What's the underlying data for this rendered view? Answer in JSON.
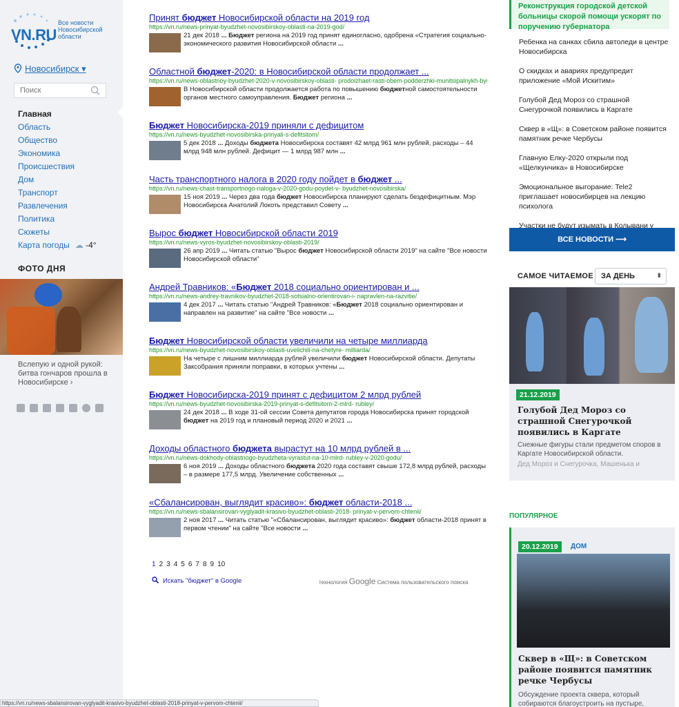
{
  "sidebar": {
    "logo": "VN.RU",
    "logo_sub": "Все новости Новосибирской области",
    "city": "Новосибирск ▾",
    "search_placeholder": "Поиск",
    "nav": [
      "Главная",
      "Область",
      "Общество",
      "Экономика",
      "Происшествия",
      "Дом",
      "Транспорт",
      "Развлечения",
      "Политика",
      "Сюжеты",
      "Карта погоды"
    ],
    "weather": "-4°",
    "photo_title": "ФОТО ДНЯ",
    "photo_caption": "Вслепую и одной рукой: битва гончаров прошла в Новосибирске ›",
    "socials": [
      "vk-icon",
      "twitter-icon",
      "youtube-icon",
      "rss-icon",
      "odnoklassniki-icon",
      "telegram-icon",
      "mail-icon"
    ]
  },
  "results": [
    {
      "title_pre": "Принят ",
      "title_b": "бюджет",
      "title_post": " Новосибирской области на 2019 год",
      "url": "https://vn.ru/news-prinyat-byudzhet-novosibirskoy-oblasti-na-2019-god/",
      "snippet": "21 дек 2018 ... Бюджет региона на 2019 год принят единогласно, одобрена «Стратегия социально-экономического развития Новосибирской области ...",
      "thumb": "#8a6a4a"
    },
    {
      "title_pre": "Областной ",
      "title_b": "бюджет",
      "title_post": "-2020: в Новосибирской области продолжает ...",
      "url": "https://vn.ru/news-oblastnoy-byudzhet-2020-v-novosibirskoy-oblasti- prodolzhaet-rasti-obem-podderzhki-munitsipalnykh-byu/",
      "snippet": "В Новосибирской области продолжается работа по повышению бюджетной самостоятельности органов местного самоуправления. Бюджет региона ...",
      "thumb": "#a0622e"
    },
    {
      "title_pre": "",
      "title_b": "Бюджет",
      "title_post": " Новосибирска-2019 приняли с дефицитом",
      "url": "https://vn.ru/news-byudzhet-novosibirska-prinyali-s-defitsitom/",
      "snippet": "5 дек 2018 ... Доходы бюджета Новосибирска составят 42 млрд 961 млн рублей, расходы – 44 млрд 948 млн рублей. Дефицит — 1 млрд 987 млн ...",
      "thumb": "#6f7d8c"
    },
    {
      "title_pre": "Часть транспортного налога в 2020 году пойдет в ",
      "title_b": "бюджет",
      "title_post": " ...",
      "url": "https://vn.ru/news-chast-transportnogo-naloga-v-2020-godu-poydet-v- byudzhet-novosibirska/",
      "snippet": "15 ноя 2019 ... Через два года бюджет Новосибирска планируют сделать бездефицитным. Мэр Новосибирска Анатолий Локоть представил Совету ...",
      "thumb": "#b08c6a"
    },
    {
      "title_pre": "Вырос ",
      "title_b": "бюджет",
      "title_post": " Новосибирской области 2019",
      "url": "https://vn.ru/news-vyros-byudzhet-novosibirskoy-oblasti-2019/",
      "snippet": "26 апр 2019 ... Читать статью \"Вырос бюджет Новосибирской области 2019\" на сайте \"Все новости Новосибирской области\"",
      "thumb": "#5a6b80"
    },
    {
      "title_pre": "Андрей Травников: «",
      "title_b": "Бюджет",
      "title_post": " 2018 социально ориентирован и ...",
      "url": "https://vn.ru/news-andrey-travnikov-byudzhet-2018-sotsialno-orientirovan-i- napravlen-na-razvitie/",
      "snippet": "4 дек 2017 ... Читать статью \"Андрей Травников: «Бюджет 2018 социально ориентирован и направлен на развитие\" на сайте \"Все новости ...",
      "thumb": "#4a6fa5"
    },
    {
      "title_pre": "",
      "title_b": "Бюджет",
      "title_post": " Новосибирской области увеличили на четыре миллиарда",
      "url": "https://vn.ru/news-byudzhet-novosibirskoy-oblasti-uvelichili-na-chetyre- milliarda/",
      "snippet": "На четыре с лишним миллиарда рублей увеличили бюджет Новосибирской области. Депутаты Заксобрания приняли поправки, в которых учтены ...",
      "thumb": "#c9a227"
    },
    {
      "title_pre": "",
      "title_b": "Бюджет",
      "title_post": " Новосибирска-2019 принят с дефицитом 2 млрд рублей",
      "url": "https://vn.ru/news-byudzhet-novosibirska-2019-prinyat-s-defitsitom-2-mlrd- rubley/",
      "snippet": "24 дек 2018 ... В ходе 31-ой сессии Совета депутатов города Новосибирска принят городской бюджет на 2019 год и плановый период 2020 и 2021 ...",
      "thumb": "#8b8f94"
    },
    {
      "title_pre": "Доходы областного ",
      "title_b": "бюджета",
      "title_post": " вырастут на 10 млрд рублей в ...",
      "url": "https://vn.ru/news-dokhody-oblastnogo-byudzheta-vyrastut-na-10-mlrd- rubley-v-2020-godu/",
      "snippet": "6 ноя 2019 ... Доходы областного бюджета 2020 года составят свыше 172,8 млрд рублей, расходы – в размере 177,5 млрд. Увеличение собственных ...",
      "thumb": "#7a6a5c"
    },
    {
      "title_pre": "«Сбалансирован, выглядит красиво»: ",
      "title_b": "бюджет",
      "title_post": " области-2018 ...",
      "url": "https://vn.ru/news-sbalansirovan-vyglyadit-krasivo-byudzhet-oblasti-2018- prinyat-v-pervom-chtenii/",
      "snippet": "2 ноя 2017 ... Читать статью \"«Сбалансирован, выглядит красиво»: бюджет области-2018 принят в первом чтении\" на сайте \"Все новости ...",
      "thumb": "#94a0ae"
    }
  ],
  "pager": [
    "1",
    "2",
    "3",
    "4",
    "5",
    "6",
    "7",
    "8",
    "9",
    "10"
  ],
  "google_search": "Искать \"бюджет\" в Google",
  "powered_pre": "технология",
  "powered_google": "Google",
  "powered_post": "Система пользовательского поиска",
  "right": {
    "highlight": "Реконструкция городской детской больницы скорой помощи ускорят по поручению губернатора",
    "news": [
      "Ребенка на санках сбила автоледи в центре Новосибирска",
      "О скидках и авариях предупредит приложение «Мой Искитим»",
      "Голубой Дед Мороз со страшной Снегурочкой появились в Каргате",
      "Сквер в «Щ»: в Советском районе появится памятник речке Чербусы",
      "Главную Елку-2020 открыли под «Щелкунчика» в Новосибирске",
      "Эмоциональное выгорание: Tele2 приглашает новосибирцев на лекцию психолога",
      "Участки не будут изымать в Колывани у"
    ],
    "all_news": "ВСЕ НОВОСТИ  ⟶",
    "most_read": "САМОЕ ЧИТАЕМОЕ",
    "period": "ЗА ДЕНЬ",
    "card": {
      "date": "21.12.2019",
      "title": "Голубой Дед Мороз со страшной Снегурочкой появились в Каргате",
      "desc": "Снежные фигуры стали предметом споров в Каргате Новосибирской области.",
      "tags": "Дед Мороз и Снегурочка, Машенька и"
    },
    "popular": "ПОПУЛЯРНОЕ",
    "pop": {
      "date": "20.12.2019",
      "tag": "ДОМ",
      "title": "Сквер в «Щ»: в Советском районе появится памятник речке Чербусы",
      "desc": "Обсуждение проекта сквера, который собираются благоустроить на пустыре,"
    }
  },
  "statusbar": "https://vn.ru/news-sbalansirovan-vyglyadit-krasivo-byudzhet-oblasti-2018-prinyat-v-pervom-chtenii/"
}
